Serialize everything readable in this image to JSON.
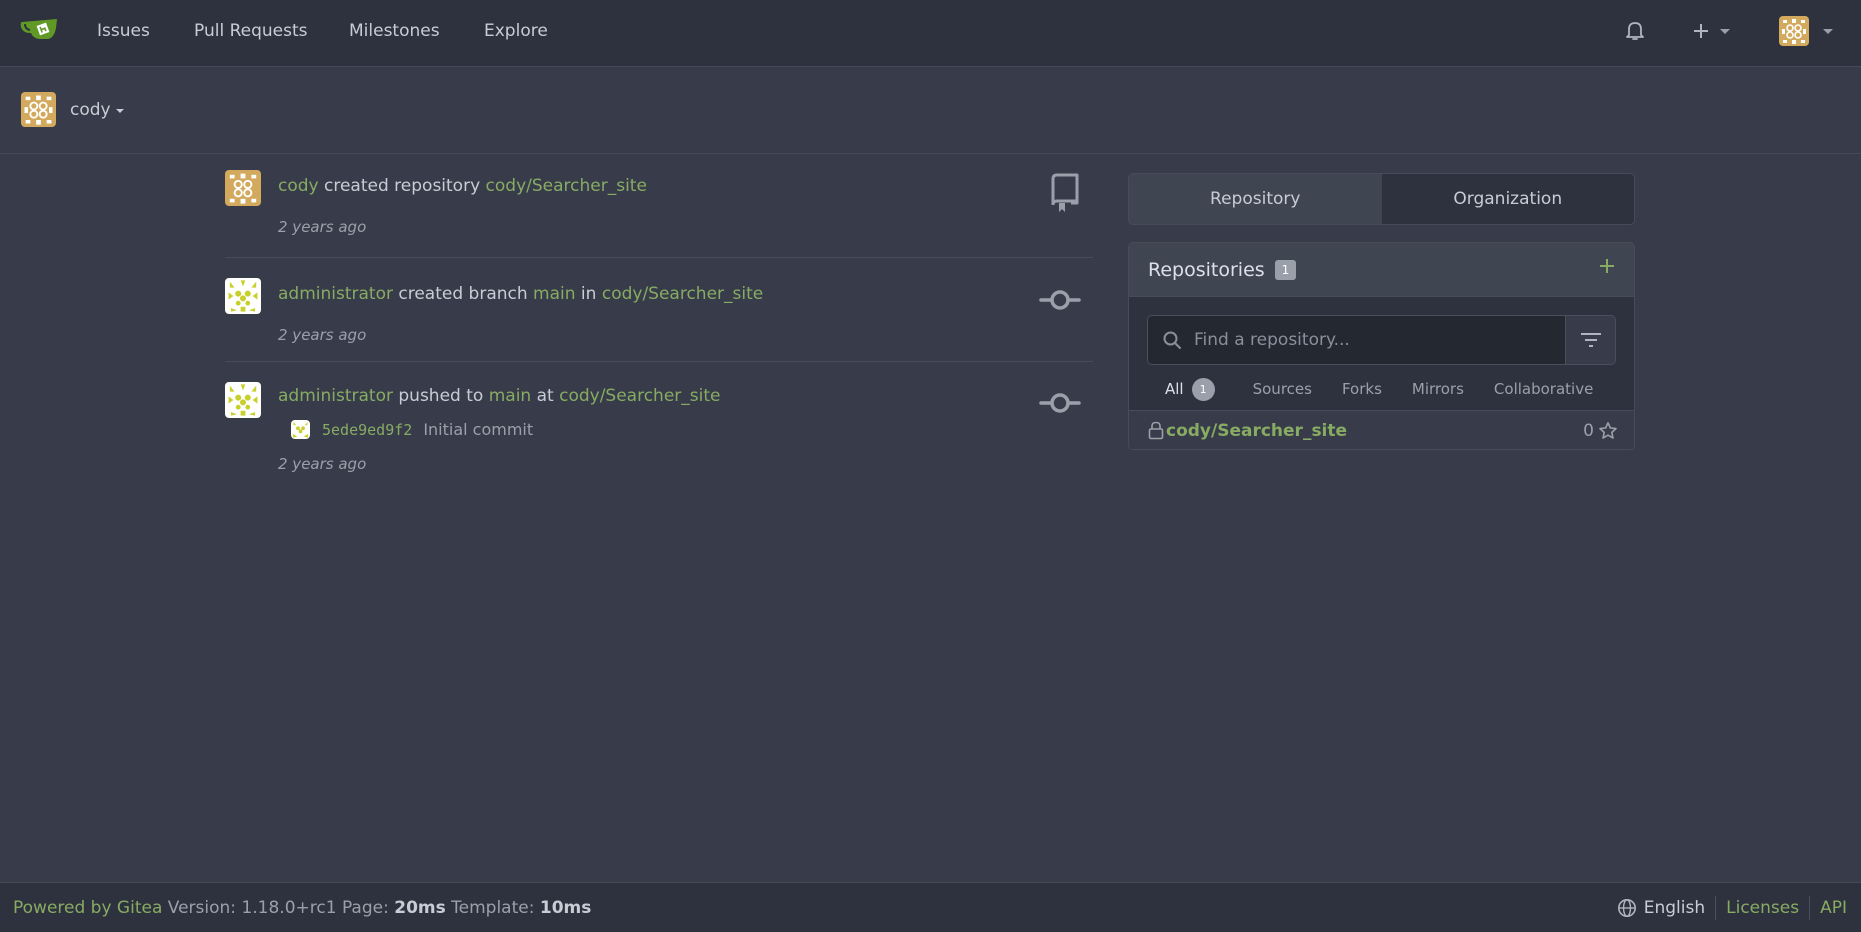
{
  "nav": {
    "logo": "gitea-logo-icon",
    "items": [
      {
        "label": "Issues"
      },
      {
        "label": "Pull Requests"
      },
      {
        "label": "Milestones"
      },
      {
        "label": "Explore"
      }
    ],
    "right_icons": [
      "bell-icon",
      "plus-icon",
      "user-avatar"
    ]
  },
  "context": {
    "username": "cody"
  },
  "feed": [
    {
      "actor": "cody",
      "action": " created repository ",
      "target": "cody/Searcher_site",
      "time": "2 years ago",
      "icon": "repo-icon",
      "avatar_color": "#d3a95e"
    },
    {
      "actor": "administrator",
      "action": " created branch ",
      "branch": "main",
      "joiner": " in ",
      "target": "cody/Searcher_site",
      "time": "2 years ago",
      "icon": "commit-icon",
      "avatar_color": "#c9d02c"
    },
    {
      "actor": "administrator",
      "action": " pushed to ",
      "branch": "main",
      "joiner": " at ",
      "target": "cody/Searcher_site",
      "commit": {
        "sha": "5ede9ed9f2",
        "message": "Initial commit"
      },
      "time": "2 years ago",
      "icon": "commit-icon",
      "avatar_color": "#c9d02c"
    }
  ],
  "panel": {
    "tabs": [
      {
        "label": "Repository",
        "active": true
      },
      {
        "label": "Organization",
        "active": false
      }
    ],
    "repos_title": "Repositories",
    "repos_count": "1",
    "search_placeholder": "Find a repository...",
    "filter_tabs": [
      {
        "label": "All",
        "count": "1",
        "active": true
      },
      {
        "label": "Sources"
      },
      {
        "label": "Forks"
      },
      {
        "label": "Mirrors"
      },
      {
        "label": "Collaborative"
      }
    ],
    "repos": [
      {
        "name": "cody/Searcher_site",
        "private": true,
        "stars": "0"
      }
    ]
  },
  "footer": {
    "powered_by": "Powered by Gitea",
    "version_label": "Version:",
    "version": "1.18.0+rc1",
    "page_label": "Page:",
    "page_time": "20ms",
    "template_label": "Template:",
    "template_time": "10ms",
    "language": "English",
    "licenses": "Licenses",
    "api": "API"
  },
  "colors": {
    "accent": "#87ab63",
    "background": "#383c4a",
    "navbar": "#2e323e"
  }
}
